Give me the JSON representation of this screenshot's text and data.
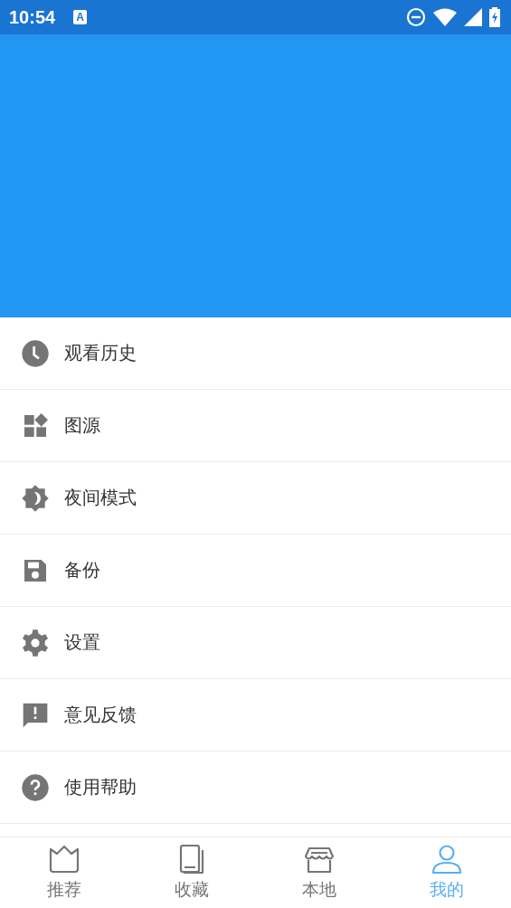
{
  "status_bar": {
    "time": "10:54",
    "notification_badge": "A"
  },
  "menu": [
    {
      "kind": "history",
      "label": "观看历史"
    },
    {
      "kind": "sources",
      "label": "图源"
    },
    {
      "kind": "night",
      "label": "夜间模式"
    },
    {
      "kind": "backup",
      "label": "备份"
    },
    {
      "kind": "settings",
      "label": "设置"
    },
    {
      "kind": "feedback",
      "label": "意见反馈"
    },
    {
      "kind": "help",
      "label": "使用帮助"
    }
  ],
  "bottom_nav": [
    {
      "kind": "recommend",
      "label": "推荐",
      "selected": false
    },
    {
      "kind": "favorites",
      "label": "收藏",
      "selected": false
    },
    {
      "kind": "local",
      "label": "本地",
      "selected": false
    },
    {
      "kind": "profile",
      "label": "我的",
      "selected": true
    }
  ]
}
